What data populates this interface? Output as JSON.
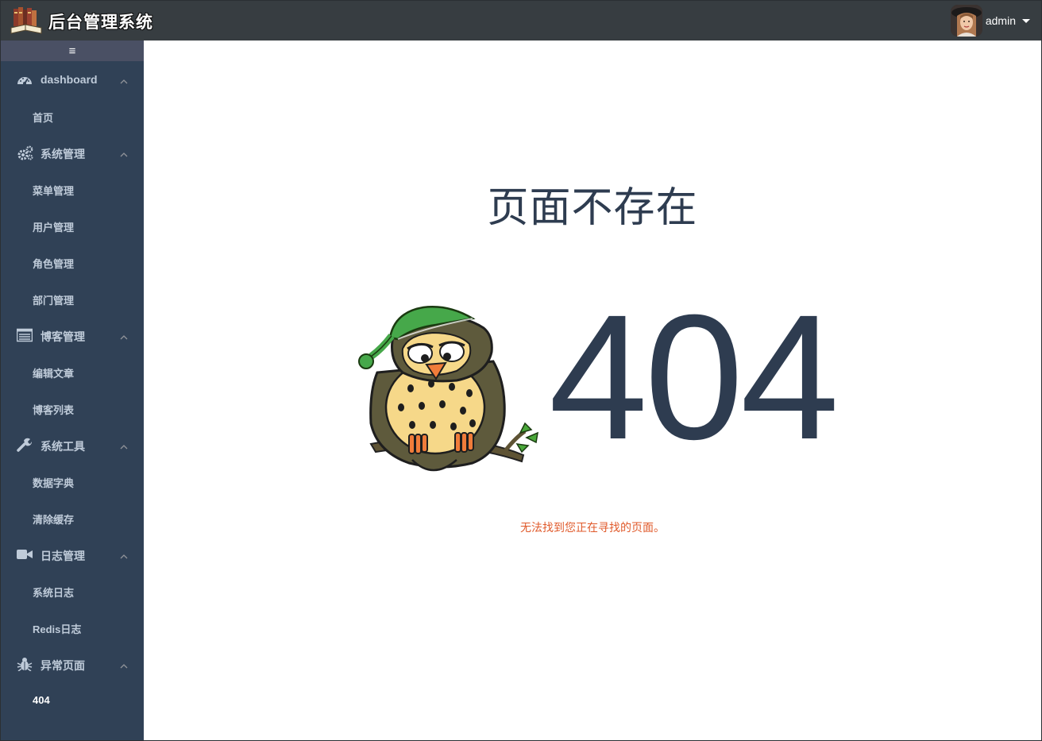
{
  "header": {
    "app_title": "后台管理系统",
    "username": "admin"
  },
  "sidebar": {
    "collapse_icon": "hamburger-icon",
    "groups": [
      {
        "label": "dashboard",
        "icon": "dashboard-icon",
        "items": [
          "首页"
        ]
      },
      {
        "label": "系统管理",
        "icon": "gears-icon",
        "items": [
          "菜单管理",
          "用户管理",
          "角色管理",
          "部门管理"
        ]
      },
      {
        "label": "博客管理",
        "icon": "list-icon",
        "items": [
          "编辑文章",
          "博客列表"
        ]
      },
      {
        "label": "系统工具",
        "icon": "wrench-icon",
        "items": [
          "数据字典",
          "清除缓存"
        ]
      },
      {
        "label": "日志管理",
        "icon": "video-camera-icon",
        "items": [
          "系统日志",
          "Redis日志"
        ]
      },
      {
        "label": "异常页面",
        "icon": "bug-icon",
        "items": [
          "404"
        ]
      }
    ],
    "active_item": "404"
  },
  "main": {
    "title": "页面不存在",
    "code": "404",
    "message": "无法找到您正在寻找的页面。",
    "illustration": "sleepy-owl-on-branch"
  },
  "colors": {
    "topbar": "#373d41",
    "sidebar": "#304156",
    "sidebar_text": "#bfcbd9",
    "heading": "#2e3c50",
    "message": "#e05a2b"
  }
}
